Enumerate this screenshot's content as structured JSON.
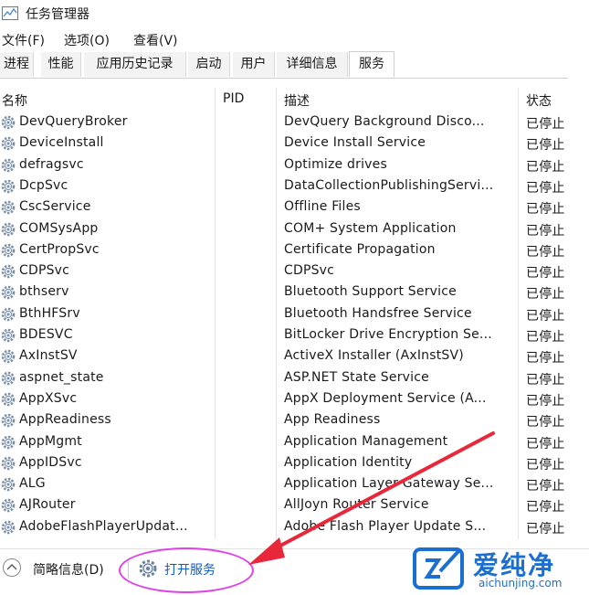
{
  "window": {
    "title": "任务管理器"
  },
  "menu": [
    "文件(F)",
    "选项(O)",
    "查看(V)"
  ],
  "tabs": [
    "进程",
    "性能",
    "应用历史记录",
    "启动",
    "用户",
    "详细信息",
    "服务"
  ],
  "active_tab": "服务",
  "columns": {
    "name": "名称",
    "pid": "PID",
    "description": "描述",
    "status": "状态"
  },
  "services": [
    {
      "name": "DevQueryBroker",
      "description": "DevQuery Background Disco...",
      "status": "已停止"
    },
    {
      "name": "DeviceInstall",
      "description": "Device Install Service",
      "status": "已停止"
    },
    {
      "name": "defragsvc",
      "description": "Optimize drives",
      "status": "已停止"
    },
    {
      "name": "DcpSvc",
      "description": "DataCollectionPublishingServi...",
      "status": "已停止"
    },
    {
      "name": "CscService",
      "description": "Offline Files",
      "status": "已停止"
    },
    {
      "name": "COMSysApp",
      "description": "COM+ System Application",
      "status": "已停止"
    },
    {
      "name": "CertPropSvc",
      "description": "Certificate Propagation",
      "status": "已停止"
    },
    {
      "name": "CDPSvc",
      "description": "CDPSvc",
      "status": "已停止"
    },
    {
      "name": "bthserv",
      "description": "Bluetooth Support Service",
      "status": "已停止"
    },
    {
      "name": "BthHFSrv",
      "description": "Bluetooth Handsfree Service",
      "status": "已停止"
    },
    {
      "name": "BDESVC",
      "description": "BitLocker Drive Encryption Se...",
      "status": "已停止"
    },
    {
      "name": "AxInstSV",
      "description": "ActiveX Installer (AxInstSV)",
      "status": "已停止"
    },
    {
      "name": "aspnet_state",
      "description": "ASP.NET State Service",
      "status": "已停止"
    },
    {
      "name": "AppXSvc",
      "description": "AppX Deployment Service (A...",
      "status": "已停止"
    },
    {
      "name": "AppReadiness",
      "description": "App Readiness",
      "status": "已停止"
    },
    {
      "name": "AppMgmt",
      "description": "Application Management",
      "status": "已停止"
    },
    {
      "name": "AppIDSvc",
      "description": "Application Identity",
      "status": "已停止"
    },
    {
      "name": "ALG",
      "description": "Application Layer Gateway Se...",
      "status": "已停止"
    },
    {
      "name": "AJRouter",
      "description": "AllJoyn Router Service",
      "status": "已停止"
    },
    {
      "name": "AdobeFlashPlayerUpdat...",
      "description": "Adobe Flash Player Update S...",
      "status": "已停止"
    }
  ],
  "footer": {
    "brief_label": "简略信息(D)",
    "open_services_label": "打开服务"
  },
  "watermark": {
    "brand_cn": "爱纯净",
    "brand_url": "aichunjing.com"
  },
  "colors": {
    "accent": "#0a5ec8",
    "highlight_ellipse": "#e040e8",
    "arrow": "#e8283a",
    "watermark": "#1b6fd0"
  },
  "icons": {
    "service": "gear-icon",
    "app": "task-manager-icon",
    "collapse": "chevron-up-icon"
  }
}
